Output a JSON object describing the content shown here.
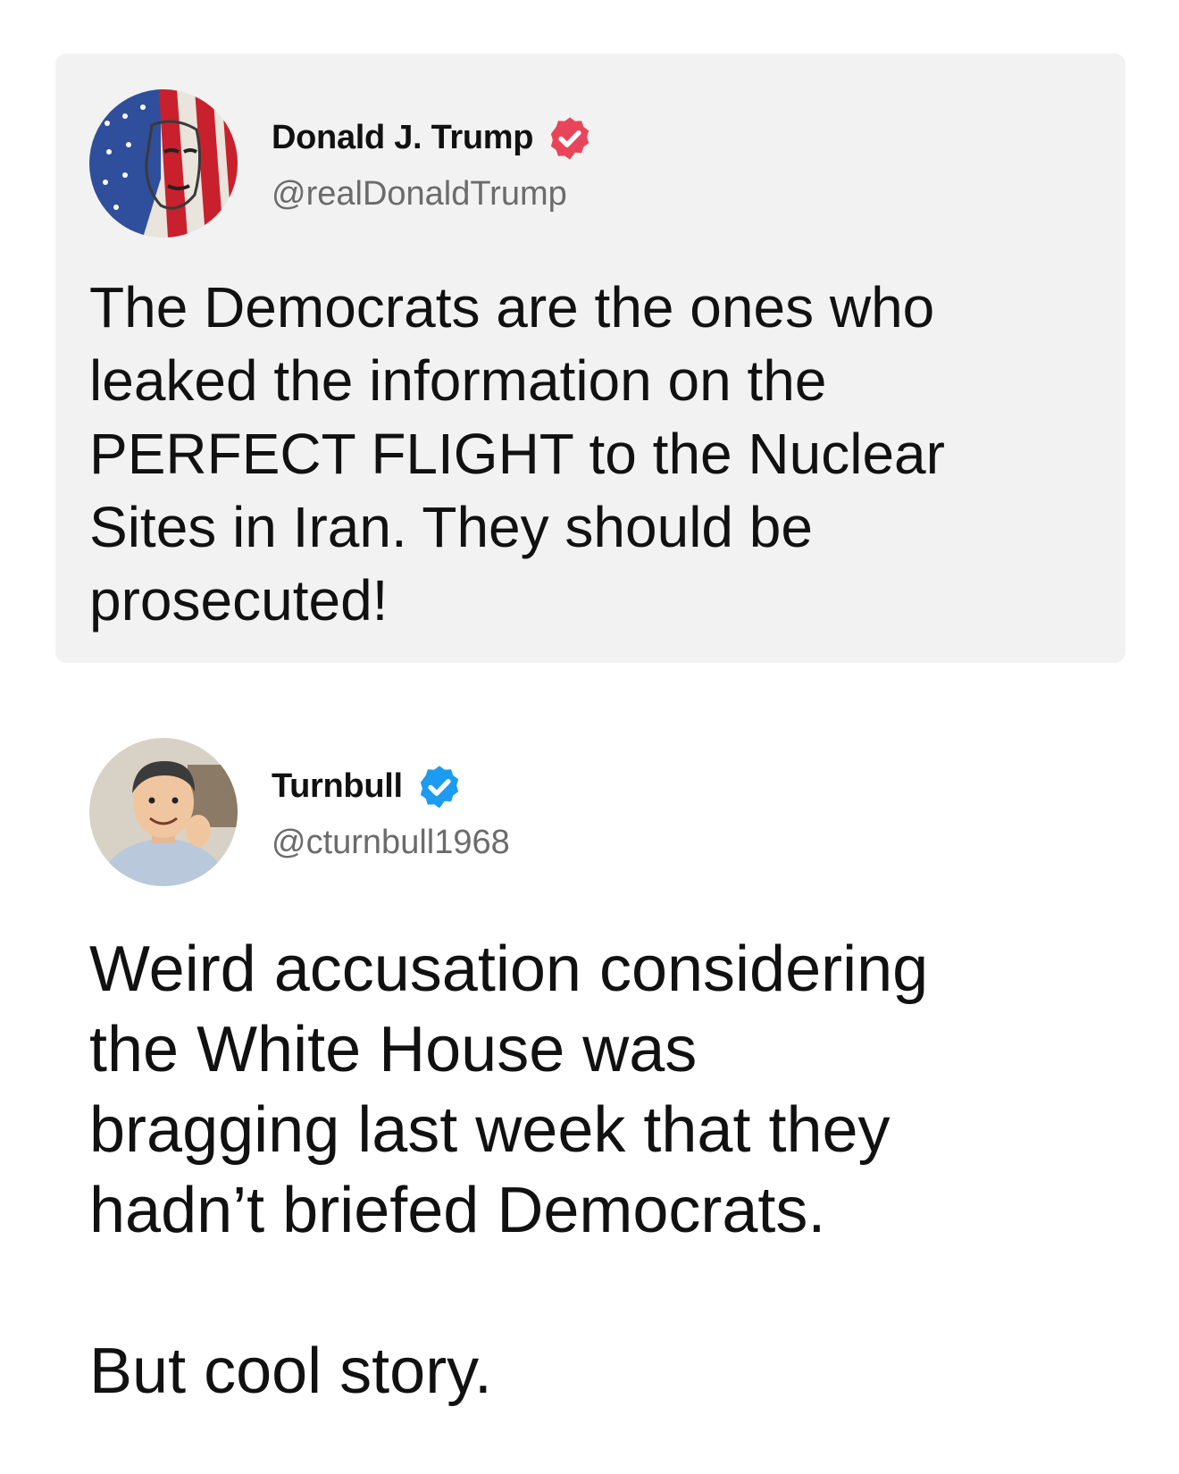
{
  "quoted_post": {
    "display_name": "Donald J. Trump",
    "handle": "@realDonaldTrump",
    "badge_icon": "verified-badge-icon",
    "badge_color": "#e8455a",
    "text": "The Democrats are the ones who\nleaked the information on the\nPERFECT FLIGHT to the Nuclear\nSites in Iran. They should be\nprosecuted!"
  },
  "reply_post": {
    "display_name": "Turnbull",
    "handle": "@cturnbull1968",
    "badge_icon": "verified-badge-icon",
    "badge_color": "#1d9bf0",
    "text": "Weird accusation considering\nthe White House was\nbragging last week that they\nhadn’t briefed Democrats.\n\nBut cool story."
  },
  "colors": {
    "card_background": "#f2f2f2",
    "handle_gray": "#6b6b6b",
    "text": "#111111"
  }
}
